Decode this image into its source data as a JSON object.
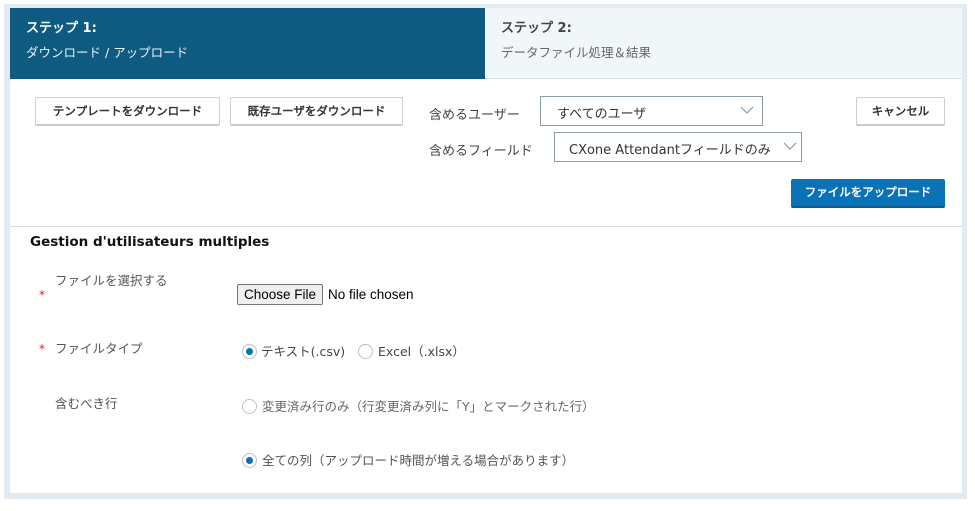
{
  "steps": [
    {
      "title": "ステップ 1:",
      "subtitle": "ダウンロード / アップロード",
      "active": true
    },
    {
      "title": "ステップ 2:",
      "subtitle": "データファイル処理＆結果",
      "active": false
    }
  ],
  "toolbar": {
    "download_template_label": "テンプレートをダウンロード",
    "download_existing_users_label": "既存ユーザをダウンロード",
    "cancel_label": "キャンセル",
    "upload_file_label": "ファイルをアップロード",
    "include_users": {
      "label": "含めるユーザー",
      "value": "すべてのユーザ"
    },
    "include_fields": {
      "label": "含めるフィールド",
      "value": "CXone Attendantフィールドのみ"
    }
  },
  "form": {
    "title": "Gestion d'utilisateurs multiples",
    "required_mark": "*",
    "file_select": {
      "label": "ファイルを選択する",
      "button_label": "Choose File",
      "status": "No file chosen",
      "required": true
    },
    "file_type": {
      "label": "ファイルタイプ",
      "required": true,
      "options": [
        {
          "label": "テキスト(.csv)",
          "checked": true
        },
        {
          "label": "Excel（.xlsx）",
          "checked": false
        }
      ]
    },
    "rows_to_include": {
      "label": "含むべき行",
      "options": [
        {
          "label": "変更済み行のみ（行変更済み列に「Y」とマークされた行）",
          "checked": false
        },
        {
          "label": "全ての列（アップロード時間が増える場合があります）",
          "checked": true
        }
      ]
    }
  },
  "colors": {
    "active_step_bg": "#0e5a80",
    "inactive_step_bg": "#f1f6f9",
    "primary_button": "#0a72b6",
    "required": "#e02020"
  }
}
